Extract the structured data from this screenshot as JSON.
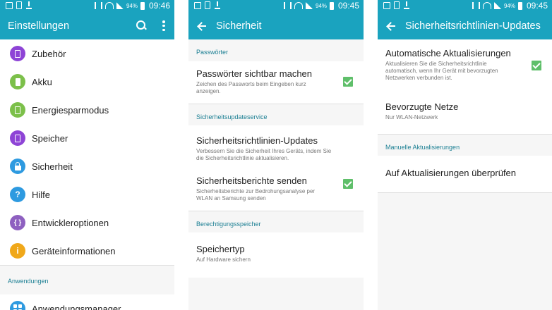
{
  "status_bar": {
    "battery_percent": "94%",
    "clocks": [
      "09:46",
      "09:45",
      "09:45"
    ]
  },
  "screen1": {
    "title": "Einstellungen",
    "items": [
      {
        "label": "Zubehör",
        "icon": "accessory-icon",
        "color": "#8e44d6"
      },
      {
        "label": "Akku",
        "icon": "battery-icon",
        "color": "#7cc04a"
      },
      {
        "label": "Energiesparmodus",
        "icon": "power-saving-icon",
        "color": "#7cc04a"
      },
      {
        "label": "Speicher",
        "icon": "storage-icon",
        "color": "#8e44d6"
      },
      {
        "label": "Sicherheit",
        "icon": "lock-icon",
        "color": "#2e9ae0"
      },
      {
        "label": "Hilfe",
        "icon": "help-icon",
        "color": "#2e9ae0"
      },
      {
        "label": "Entwickleroptionen",
        "icon": "developer-icon",
        "color": "#8e60c0"
      },
      {
        "label": "Geräteinformationen",
        "icon": "info-icon",
        "color": "#f0a81a"
      }
    ],
    "section": "Anwendungen",
    "section_items": [
      {
        "label": "Anwendungsmanager",
        "icon": "apps-icon",
        "color": "#2e9ae0"
      }
    ]
  },
  "screen2": {
    "title": "Sicherheit",
    "groups": [
      {
        "header": "Passwörter",
        "prefs": [
          {
            "title": "Passwörter sichtbar machen",
            "summary": "Zeichen des Passworts beim Eingeben kurz anzeigen.",
            "checked": true
          }
        ]
      },
      {
        "header": "Sicherheitsupdateservice",
        "prefs": [
          {
            "title": "Sicherheitsrichtlinien-Updates",
            "summary": "Verbessern Sie die Sicherheit Ihres Geräts, indem Sie die Sicherheitsrichtlinie aktualisieren.",
            "checked": false
          },
          {
            "title": "Sicherheitsberichte senden",
            "summary": "Sicherheitsberichte zur Bedrohungsanalyse per WLAN an Samsung senden",
            "checked": true
          }
        ]
      },
      {
        "header": "Berechtigungsspeicher",
        "prefs": [
          {
            "title": "Speichertyp",
            "summary": "Auf Hardware sichern",
            "checked": false
          }
        ]
      }
    ]
  },
  "screen3": {
    "title": "Sicherheitsrichtlinien-Updates",
    "prefs": [
      {
        "title": "Automatische Aktualisierungen",
        "summary": "Aktualisieren Sie die Sicherheitsrichtlinie automatisch, wenn Ihr Gerät mit bevorzugten Netzwerken verbunden ist.",
        "checked": true
      },
      {
        "title": "Bevorzugte Netze",
        "summary": "Nur WLAN-Netzwerk",
        "checked": false
      }
    ],
    "section": "Manuelle Aktualisierungen",
    "section_items": [
      {
        "title": "Auf Aktualisierungen überprüfen"
      }
    ]
  }
}
